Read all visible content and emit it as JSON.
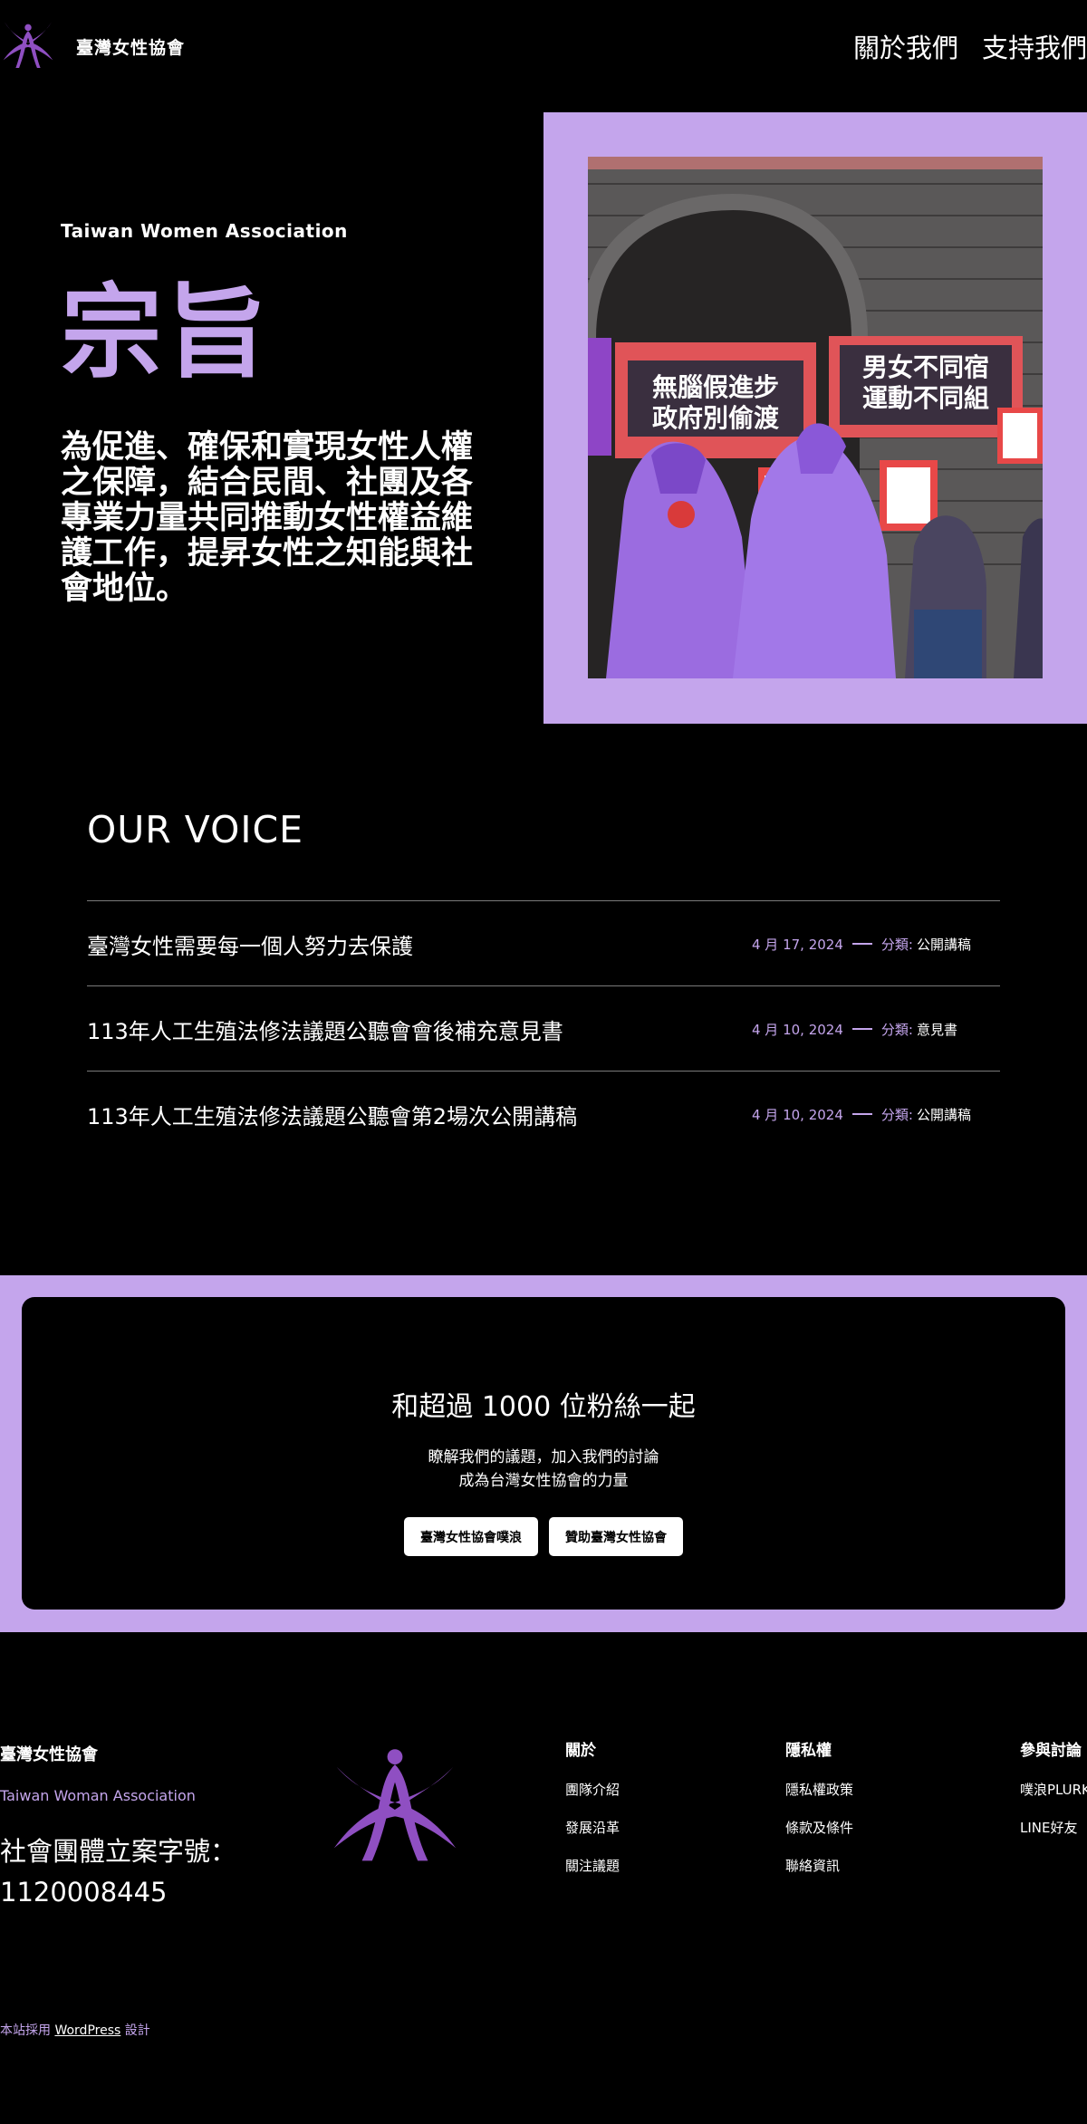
{
  "header": {
    "site_title": "臺灣女性協會",
    "nav": [
      "關於我們",
      "支持我們"
    ]
  },
  "hero": {
    "eyebrow": "Taiwan Women Association",
    "title": "宗旨",
    "text": "為促進、確保和實現女性人權之保障，結合民間、社團及各專業力量共同推動女性權益維護工作，提昇女性之知能與社會地位。",
    "photo_signs": [
      "無腦假進步",
      "政府別偷渡",
      "男女不同宿",
      "運動不同組"
    ]
  },
  "voice": {
    "heading": "OUR VOICE",
    "category_label": "分類:",
    "posts": [
      {
        "title": "臺灣女性需要每一個人努力去保護",
        "date": "4 月 17, 2024",
        "category": "公開講稿"
      },
      {
        "title": "113年人工生殖法修法議題公聽會會後補充意見書",
        "date": "4 月 10, 2024",
        "category": "意見書"
      },
      {
        "title": "113年人工生殖法修法議題公聽會第2場次公開講稿",
        "date": "4 月 10, 2024",
        "category": "公開講稿"
      }
    ]
  },
  "cta": {
    "heading": "和超過 1000 位粉絲一起",
    "line1": "瞭解我們的議題，加入我們的討論",
    "line2": "成為台灣女性協會的力量",
    "buttons": [
      "臺灣女性協會噗浪",
      "贊助臺灣女性協會"
    ]
  },
  "footer": {
    "name": "臺灣女性協會",
    "english_name": "Taiwan Woman Association",
    "registration": "社會團體立案字號：1120008445",
    "columns": [
      {
        "heading": "關於",
        "links": [
          "團隊介紹",
          "發展沿革",
          "關注議題"
        ]
      },
      {
        "heading": "隱私權",
        "links": [
          "隱私權政策",
          "條款及條件",
          "聯絡資訊"
        ]
      },
      {
        "heading": "參與討論",
        "links": [
          "噗浪PLURK",
          "LINE好友"
        ]
      }
    ],
    "credit_prefix": "本站採用",
    "credit_link": "WordPress",
    "credit_suffix": "設計"
  },
  "colors": {
    "accent": "#c4a5ec",
    "logo": "#8f4fc2",
    "background": "#000000"
  }
}
